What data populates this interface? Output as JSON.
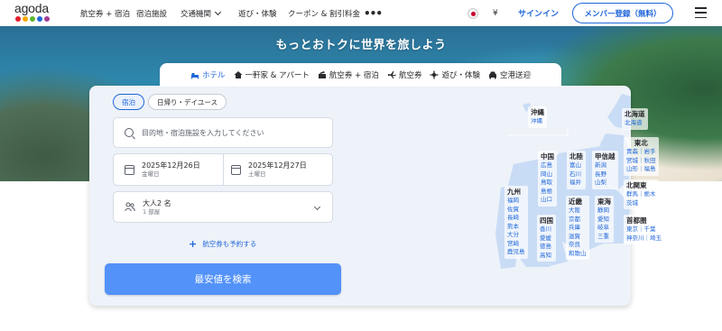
{
  "header": {
    "logo_text": "agoda",
    "logo_dot_colors": [
      "#e21e2d",
      "#f7a600",
      "#5bb531",
      "#2067da",
      "#a23d96"
    ],
    "nav": [
      {
        "label": "航空券 + 宿泊"
      },
      {
        "label": "宿泊施設"
      },
      {
        "label": "交通機関"
      },
      {
        "label": "遊び・体験"
      },
      {
        "label": "クーポン & 割引料金"
      }
    ],
    "more": "•••",
    "currency": "¥",
    "signin": "サインイン",
    "register": "メンバー登録（無料）"
  },
  "hero": {
    "title": "もっとおトクに世界を旅しよう"
  },
  "product_tabs": [
    {
      "label": "ホテル",
      "icon": "hotel-icon",
      "active": true
    },
    {
      "label": "一軒家 & アパート",
      "icon": "house-icon"
    },
    {
      "label": "航空券 + 宿泊",
      "icon": "package-icon"
    },
    {
      "label": "航空券",
      "icon": "plane-icon"
    },
    {
      "label": "遊び・体験",
      "icon": "activity-icon"
    },
    {
      "label": "空港送迎",
      "icon": "car-icon"
    }
  ],
  "search": {
    "stay_types": [
      {
        "label": "宿泊",
        "active": true
      },
      {
        "label": "日帰り・デイユース"
      }
    ],
    "destination_placeholder": "目的地・宿泊施設を入力してください",
    "checkin": {
      "date": "2025年12月26日",
      "weekday": "金曜日"
    },
    "checkout": {
      "date": "2025年12月27日",
      "weekday": "土曜日"
    },
    "guests": {
      "summary": "大人2 名",
      "rooms": "1 部屋"
    },
    "add_flight": "航空券も予約する",
    "submit": "最安値を検索"
  },
  "map": {
    "regions": {
      "okinawa": {
        "name": "沖縄",
        "prefs": [
          "沖縄"
        ]
      },
      "hokkaido": {
        "name": "北海道",
        "prefs": [
          "北海道"
        ]
      },
      "tohoku": {
        "name": "東北",
        "rows": [
          "青森｜岩手",
          "宮城｜秋田",
          "山形｜福島"
        ]
      },
      "chugoku": {
        "name": "中国",
        "prefs": [
          "広島",
          "岡山",
          "鳥取",
          "島根",
          "山口"
        ]
      },
      "hokuriku": {
        "name": "北陸",
        "prefs": [
          "富山",
          "石川",
          "福井"
        ]
      },
      "koshinetsu": {
        "name": "甲信越",
        "prefs": [
          "新潟",
          "長野",
          "山梨"
        ]
      },
      "kitakanto": {
        "name": "北関東",
        "rows": [
          "群馬｜栃木",
          "茨城"
        ]
      },
      "kyushu": {
        "name": "九州",
        "prefs": [
          "福岡",
          "佐賀",
          "長崎",
          "熊本",
          "大分",
          "宮崎",
          "鹿児島"
        ]
      },
      "kinki": {
        "name": "近畿",
        "prefs": [
          "大阪",
          "京都",
          "兵庫",
          "滋賀",
          "奈良",
          "和歌山"
        ]
      },
      "tokai": {
        "name": "東海",
        "prefs": [
          "静岡",
          "愛知",
          "岐阜",
          "三重"
        ]
      },
      "shushoken": {
        "name": "首都圏",
        "rows": [
          "東京｜千葉",
          "神奈川｜埼玉"
        ]
      },
      "shikoku": {
        "name": "四国",
        "prefs": [
          "香川",
          "愛媛",
          "徳島",
          "高知"
        ]
      }
    }
  },
  "colors": {
    "accent": "#2067da",
    "search_button": "#5392f9",
    "card_background": "#eef2f9"
  }
}
